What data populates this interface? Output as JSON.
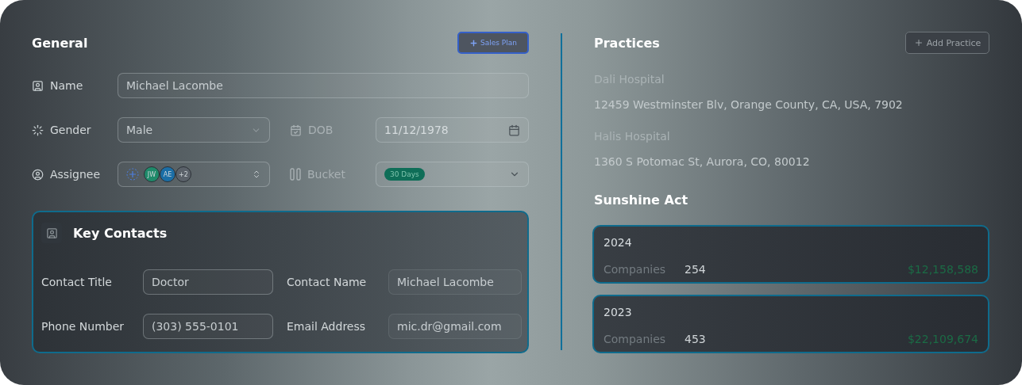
{
  "general": {
    "title": "General",
    "action": "Sales Plan",
    "name": {
      "label": "Name",
      "value": "Michael Lacombe"
    },
    "gender": {
      "label": "Gender",
      "value": "Male"
    },
    "dob": {
      "label": "DOB",
      "placeholder": "11/12/1978"
    },
    "assignee": {
      "label": "Assignee",
      "avatars": [
        {
          "initials": "JW",
          "color": "#1f8a6a"
        },
        {
          "initials": "AE",
          "color": "#1b6ea6"
        },
        {
          "initials": "+2",
          "color": "#5b626a"
        }
      ]
    },
    "bucket": {
      "label": "Bucket",
      "tag": "30 Days"
    }
  },
  "key_contacts": {
    "title": "Key Contacts",
    "fields": [
      {
        "label": "Contact Title",
        "value": "Doctor"
      },
      {
        "label": "Contact Name",
        "value": "Michael Lacombe"
      },
      {
        "label": "Phone Number",
        "value": "(303) 555-0101"
      },
      {
        "label": "Email Address",
        "value": "mic.dr@gmail.com"
      }
    ]
  },
  "practices": {
    "title": "Practices",
    "action": "Add Practice",
    "items": [
      {
        "name": "Dali Hospital",
        "address": "12459 Westminster Blv, Orange County, CA, USA, 7902"
      },
      {
        "name": "Halis Hospital",
        "address": "1360 S Potomac St, Aurora, CO, 80012"
      }
    ]
  },
  "sunshine_act": {
    "title": "Sunshine Act",
    "cards": [
      {
        "year": "2024",
        "label": "Companies",
        "count": "254",
        "amount": "$12,158,588"
      },
      {
        "year": "2023",
        "label": "Companies",
        "count": "453",
        "amount": "$22,109,674"
      }
    ]
  }
}
